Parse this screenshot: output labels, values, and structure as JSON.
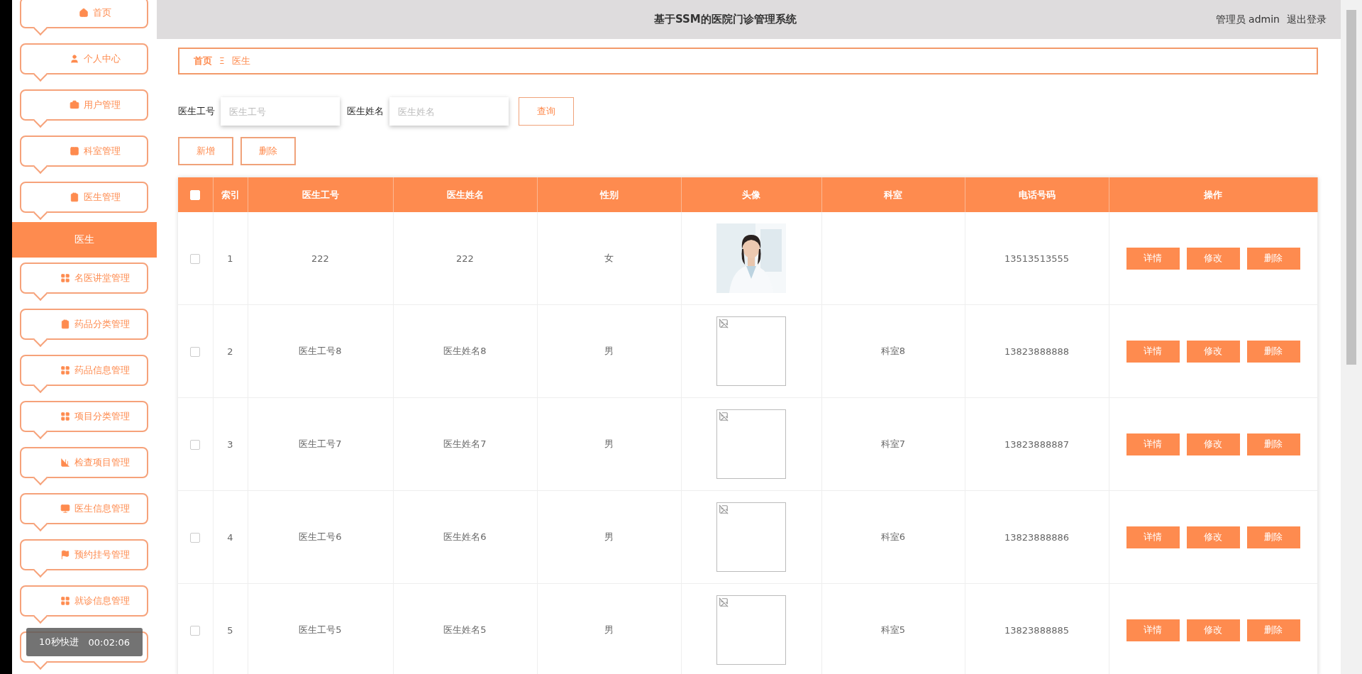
{
  "sidebar": {
    "items": [
      {
        "label": "首页",
        "selected": false
      },
      {
        "label": "个人中心",
        "selected": false
      },
      {
        "label": "用户管理",
        "selected": false
      },
      {
        "label": "科室管理",
        "selected": false
      },
      {
        "label": "医生管理",
        "selected": false,
        "expanded": true,
        "children": [
          {
            "label": "医生",
            "selected": true
          }
        ]
      },
      {
        "label": "名医讲堂管理",
        "selected": false
      },
      {
        "label": "药品分类管理",
        "selected": false
      },
      {
        "label": "药品信息管理",
        "selected": false
      },
      {
        "label": "项目分类管理",
        "selected": false
      },
      {
        "label": "检查项目管理",
        "selected": false
      },
      {
        "label": "医生信息管理",
        "selected": false
      },
      {
        "label": "预约挂号管理",
        "selected": false
      },
      {
        "label": "就诊信息管理",
        "selected": false
      },
      {
        "kind": "covered",
        "selected": false
      }
    ]
  },
  "header": {
    "title": "基于SSM的医院门诊管理系统",
    "user": "管理员 admin",
    "logout": "退出登录"
  },
  "breadcrumb": {
    "items": [
      "首页",
      "医生"
    ],
    "separator": "Ξ"
  },
  "search": {
    "fields": [
      {
        "label": "医生工号",
        "placeholder": "医生工号"
      },
      {
        "label": "医生姓名",
        "placeholder": "医生姓名"
      }
    ],
    "button": "查询"
  },
  "actions": [
    "新增",
    "删除"
  ],
  "table": {
    "columns": [
      "索引",
      "医生工号",
      "医生姓名",
      "性别",
      "头像",
      "科室",
      "电话号码",
      "操作"
    ],
    "select_all": false,
    "rows": [
      {
        "index": "1",
        "id": "222",
        "name": "222",
        "gender": "女",
        "dept": "",
        "phone": "13513513555",
        "checked": false,
        "actions": [
          "详情",
          "修改",
          "删除"
        ]
      },
      {
        "index": "2",
        "id": "医生工号8",
        "name": "医生姓名8",
        "gender": "男",
        "avatar": {
          "kind": "broken"
        },
        "dept": "科室8",
        "phone": "13823888888",
        "checked": false,
        "actions": [
          "详情",
          "修改",
          "删除"
        ]
      },
      {
        "index": "3",
        "id": "医生工号7",
        "name": "医生姓名7",
        "gender": "男",
        "avatar": {
          "kind": "broken"
        },
        "dept": "科室7",
        "phone": "13823888887",
        "checked": false,
        "actions": [
          "详情",
          "修改",
          "删除"
        ]
      },
      {
        "index": "4",
        "id": "医生工号6",
        "name": "医生姓名6",
        "gender": "男",
        "avatar": {
          "kind": "broken"
        },
        "dept": "科室6",
        "phone": "13823888886",
        "checked": false,
        "actions": [
          "详情",
          "修改",
          "删除"
        ]
      },
      {
        "index": "5",
        "id": "医生工号5",
        "name": "医生姓名5",
        "gender": "男",
        "avatar": {
          "kind": "broken"
        },
        "dept": "科室5",
        "phone": "13823888885",
        "checked": false,
        "actions": [
          "详情",
          "修改",
          "删除"
        ]
      }
    ]
  },
  "player_toast": {
    "label": "10秒快进",
    "time": "00:02:06"
  }
}
